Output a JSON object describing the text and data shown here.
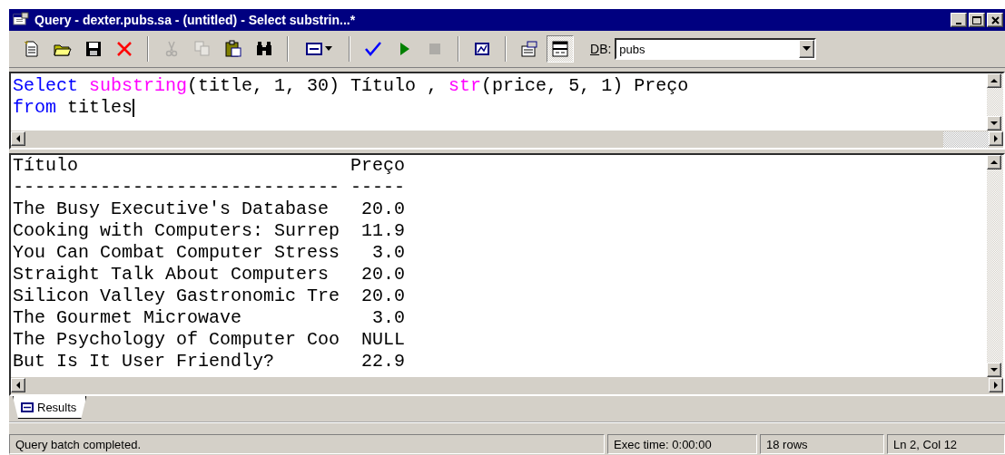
{
  "window": {
    "title": "Query - dexter.pubs.sa - (untitled) - Select substrin...*"
  },
  "toolbar": {
    "groups": [
      [
        {
          "kind": "new",
          "disabled": false,
          "pressed": false
        },
        {
          "kind": "open",
          "disabled": false,
          "pressed": false
        },
        {
          "kind": "save",
          "disabled": false,
          "pressed": false
        },
        {
          "kind": "delete",
          "disabled": false,
          "pressed": false
        }
      ],
      [
        {
          "kind": "cut",
          "disabled": true,
          "pressed": false
        },
        {
          "kind": "copy",
          "disabled": true,
          "pressed": false
        },
        {
          "kind": "paste",
          "disabled": false,
          "pressed": false
        },
        {
          "kind": "find",
          "disabled": false,
          "pressed": false
        }
      ],
      [
        {
          "kind": "results-mode",
          "disabled": false,
          "pressed": false
        }
      ],
      [
        {
          "kind": "parse",
          "disabled": false,
          "pressed": false
        },
        {
          "kind": "execute",
          "disabled": false,
          "pressed": false
        },
        {
          "kind": "stop",
          "disabled": true,
          "pressed": false
        }
      ],
      [
        {
          "kind": "plan",
          "disabled": false,
          "pressed": false
        }
      ],
      [
        {
          "kind": "properties",
          "disabled": false,
          "pressed": false
        },
        {
          "kind": "results-pane",
          "disabled": false,
          "pressed": true
        }
      ]
    ],
    "database": {
      "label": "DB:",
      "value": "pubs"
    }
  },
  "editor": {
    "lines": [
      {
        "caret": false,
        "tokens": [
          {
            "kind": "keyword",
            "text": "Select "
          },
          {
            "kind": "function",
            "text": "substring"
          },
          {
            "kind": "plain",
            "text": "(title, 1, 30) Título , "
          },
          {
            "kind": "function",
            "text": "str"
          },
          {
            "kind": "plain",
            "text": "(price, 5, 1) Preço"
          }
        ]
      },
      {
        "caret": true,
        "tokens": [
          {
            "kind": "keyword",
            "text": "from"
          },
          {
            "kind": "plain",
            "text": " titles"
          }
        ]
      }
    ]
  },
  "results": {
    "columns": [
      {
        "header": "Título",
        "rule": "------------------------------"
      },
      {
        "header": "Preço",
        "rule": "-----"
      }
    ],
    "rows": [
      [
        "The Busy Executive's Database",
        "20.0"
      ],
      [
        "Cooking with Computers: Surrep",
        "11.9"
      ],
      [
        "You Can Combat Computer Stress",
        "3.0"
      ],
      [
        "Straight Talk About Computers",
        "20.0"
      ],
      [
        "Silicon Valley Gastronomic Tre",
        "20.0"
      ],
      [
        "The Gourmet Microwave",
        "3.0"
      ],
      [
        "The Psychology of Computer Coo",
        "NULL"
      ],
      [
        "But Is It User Friendly?",
        "22.9"
      ]
    ]
  },
  "tabs": [
    {
      "label": "Results",
      "selected": true
    }
  ],
  "status_bar": {
    "message": "Query batch completed.",
    "exec_time": "Exec time: 0:00:00",
    "rows": "18 rows",
    "position": "Ln 2, Col 12"
  }
}
